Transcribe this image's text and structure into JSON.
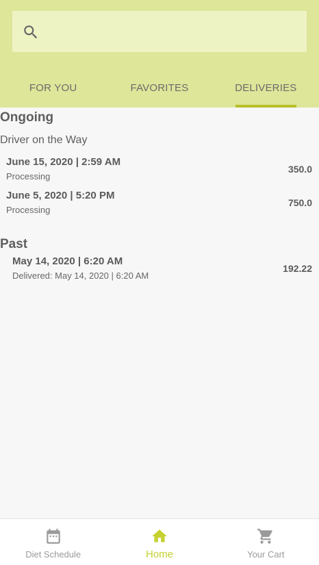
{
  "search": {
    "placeholder": "",
    "icon": "search-icon"
  },
  "tabs": [
    {
      "label": "FOR YOU",
      "active": false
    },
    {
      "label": "FAVORITES",
      "active": false
    },
    {
      "label": "DELIVERIES",
      "active": true
    }
  ],
  "ongoing": {
    "title": "Ongoing",
    "subtitle": "Driver on the Way",
    "orders": [
      {
        "date": "June 15, 2020 | 2:59 AM",
        "status": "Processing",
        "amount": "350.0"
      },
      {
        "date": "June 5, 2020 | 5:20 PM",
        "status": "Processing",
        "amount": "750.0"
      }
    ]
  },
  "past": {
    "title": "Past",
    "orders": [
      {
        "date": "May 14, 2020 | 6:20 AM",
        "status": "Delivered: May 14, 2020 | 6:20 AM",
        "amount": "192.22"
      }
    ]
  },
  "bottom_nav": [
    {
      "label": "Diet Schedule",
      "icon": "calendar-icon",
      "active": false
    },
    {
      "label": "Home",
      "icon": "home-icon",
      "active": true
    },
    {
      "label": "Your Cart",
      "icon": "cart-icon",
      "active": false
    }
  ],
  "colors": {
    "header": "#dde699",
    "search_bg": "#eef3c4",
    "accent": "#b8bf2b",
    "active_nav": "#c5d12f",
    "background": "#f7f7f7"
  }
}
